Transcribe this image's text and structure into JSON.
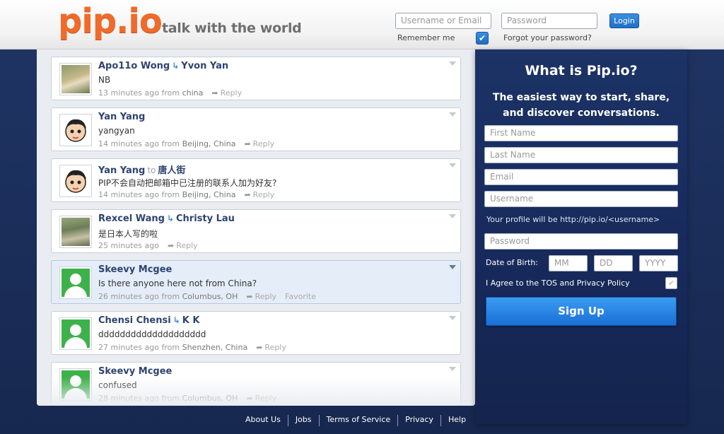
{
  "header": {
    "logo": "pip.io",
    "tagline": "talk with the world",
    "username_placeholder": "Username or Email",
    "password_placeholder": "Password",
    "login_label": "Login",
    "remember_label": "Remember me",
    "forgot_label": "Forgot your password?"
  },
  "feed": {
    "posts": [
      {
        "author": "Apo11o Wong",
        "recipient": "Yvon Yan",
        "link": "reply",
        "message": "NB",
        "time": "13 minutes ago",
        "from": "from",
        "location": "china",
        "reply": "Reply",
        "favorite": ""
      },
      {
        "author": "Yan Yang",
        "recipient": "",
        "link": "",
        "message": "yangyan",
        "time": "14 minutes ago",
        "from": "from",
        "location": "Beijing, China",
        "reply": "Reply",
        "favorite": ""
      },
      {
        "author": "Yan Yang",
        "recipient": "唐人街",
        "link": "to",
        "message": "PIP不会自动把邮箱中已注册的联系人加为好友?",
        "time": "14 minutes ago",
        "from": "from",
        "location": "Beijing, China",
        "reply": "Reply",
        "favorite": ""
      },
      {
        "author": "Rexcel Wang",
        "recipient": "Christy Lau",
        "link": "reply",
        "message": "是日本人写的啦",
        "time": "25 minutes ago",
        "from": "",
        "location": "",
        "reply": "Reply",
        "favorite": ""
      },
      {
        "author": "Skeevy Mcgee",
        "recipient": "",
        "link": "",
        "message": "Is there anyone here not from China?",
        "time": "26 minutes ago",
        "from": "from",
        "location": "Columbus, OH",
        "reply": "Reply",
        "favorite": "Favorite"
      },
      {
        "author": "Chensi Chensi",
        "recipient": "K K",
        "link": "reply",
        "message": "dddddddddddddddddddd",
        "time": "27 minutes ago",
        "from": "from",
        "location": "Shenzhen, China",
        "reply": "Reply",
        "favorite": ""
      },
      {
        "author": "Skeevy Mcgee",
        "recipient": "",
        "link": "",
        "message": "confused",
        "time": "28 minutes ago",
        "from": "from",
        "location": "Columbus, OH",
        "reply": "Reply",
        "favorite": ""
      }
    ],
    "to_word": "to",
    "reply_arrow": "↳"
  },
  "signup": {
    "title": "What is Pip.io?",
    "subtitle": "The easiest way to start, share, and discover conversations.",
    "first_name_placeholder": "First Name",
    "last_name_placeholder": "Last Name",
    "email_placeholder": "Email",
    "username_placeholder": "Username",
    "profile_note": "Your profile will be http://pip.io/<username>",
    "password_placeholder": "Password",
    "dob_label": "Date of Birth:",
    "dob_mm": "MM",
    "dob_dd": "DD",
    "dob_yyyy": "YYYY",
    "tos_label": "I Agree to the TOS and Privacy Policy",
    "signup_label": "Sign Up"
  },
  "footer": {
    "links": [
      "About Us",
      "Jobs",
      "Terms of Service",
      "Privacy",
      "Help"
    ]
  },
  "colors": {
    "logo": "#f06a2a",
    "background": "#1d2c52",
    "accent": "#1e6fc6"
  }
}
